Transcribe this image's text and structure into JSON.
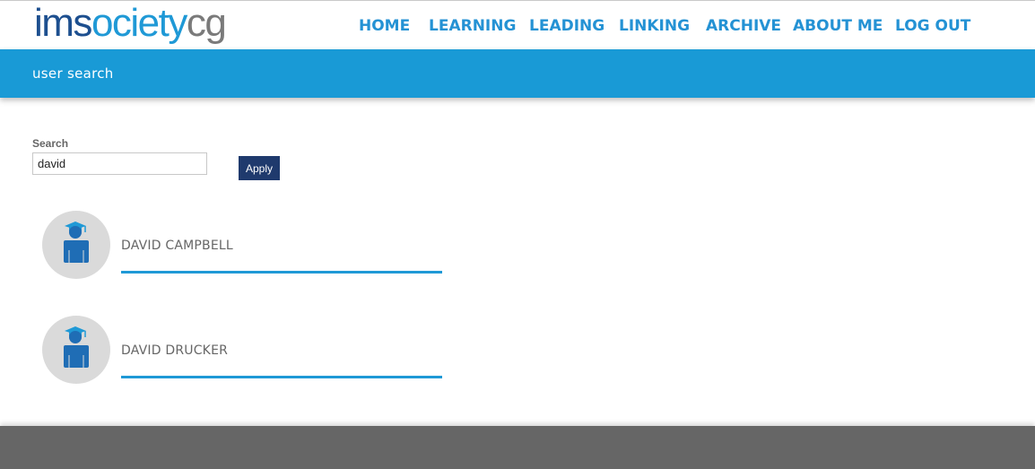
{
  "logo": {
    "part1": "ims",
    "part2": "ociety",
    "part3": "cg"
  },
  "nav": [
    {
      "label": "HOME"
    },
    {
      "label": "LEARNING"
    },
    {
      "label": "LEADING"
    },
    {
      "label": "LINKING"
    },
    {
      "label": "ARCHIVE"
    },
    {
      "label": "ABOUT ME"
    },
    {
      "label": "LOG OUT"
    }
  ],
  "page_title": "user search",
  "search": {
    "label": "Search",
    "value": "david",
    "button": "Apply"
  },
  "results": [
    {
      "name": "DAVID CAMPBELL",
      "icon": "graduate-user-icon"
    },
    {
      "name": "DAVID DRUCKER",
      "icon": "graduate-user-icon"
    }
  ],
  "colors": {
    "accent": "#199ad6",
    "button": "#1f3a6d",
    "footer": "#666666"
  }
}
